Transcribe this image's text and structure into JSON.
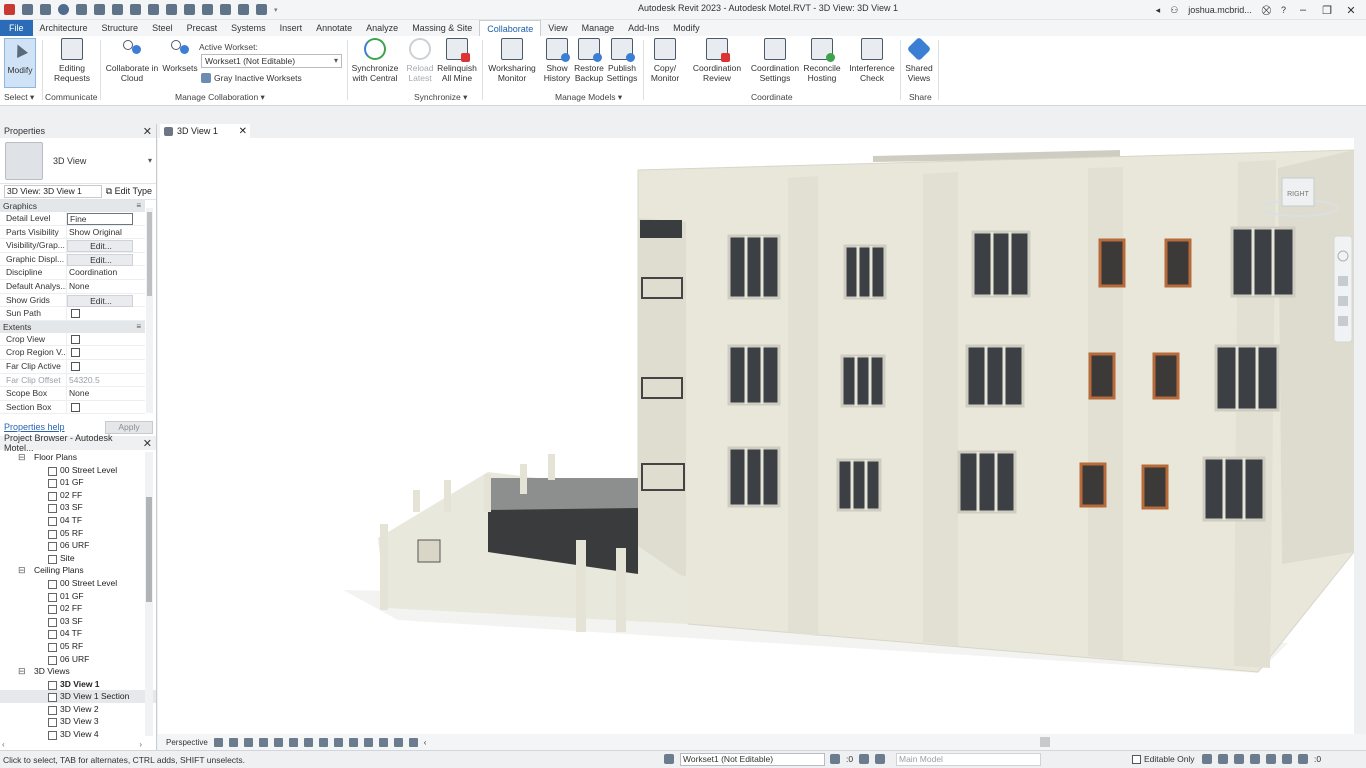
{
  "title_bar": {
    "title": "Autodesk Revit 2023 - Autodesk Motel.RVT - 3D View: 3D View 1",
    "user": "joshua.mcbrid..."
  },
  "tabs": [
    "File",
    "Architecture",
    "Structure",
    "Steel",
    "Precast",
    "Systems",
    "Insert",
    "Annotate",
    "Analyze",
    "Massing & Site",
    "Collaborate",
    "View",
    "Manage",
    "Add-Ins",
    "Modify"
  ],
  "ribbon": {
    "modify": "Modify",
    "editing_requests": "Editing\nRequests",
    "collaborate_cloud": "Collaborate in\nCloud",
    "worksets": "Worksets",
    "active_workset_label": "Active Workset:",
    "active_workset_value": "Workset1 (Not Editable)",
    "gray_inactive": "Gray Inactive Worksets",
    "sync_central": "Synchronize\nwith Central",
    "reload_latest": "Reload\nLatest",
    "relinquish": "Relinquish\nAll Mine",
    "worksharing_monitor": "Worksharing\nMonitor",
    "show_history": "Show\nHistory",
    "restore_backup": "Restore\nBackup",
    "publish_settings": "Publish\nSettings",
    "copy_monitor": "Copy/\nMonitor",
    "coordination_review": "Coordination\nReview",
    "coordination_settings": "Coordination\nSettings",
    "reconcile_hosting": "Reconcile\nHosting",
    "interference_check": "Interference\nCheck",
    "shared_views": "Shared\nViews",
    "panels": {
      "select": "Select",
      "communicate": "Communicate",
      "manage_collaboration": "Manage Collaboration",
      "synchronize": "Synchronize",
      "manage_models": "Manage Models",
      "coordinate": "Coordinate",
      "share": "Share"
    }
  },
  "properties": {
    "header": "Properties",
    "type_name": "3D View",
    "instance_selector": "3D View: 3D View 1",
    "edit_type": "Edit Type",
    "group_graphics": "Graphics",
    "group_extents": "Extents",
    "rows_graphics": [
      {
        "name": "Detail Level",
        "value": "Fine"
      },
      {
        "name": "Parts Visibility",
        "value": "Show Original"
      },
      {
        "name": "Visibility/Grap...",
        "value": "Edit..."
      },
      {
        "name": "Graphic Displ...",
        "value": "Edit..."
      },
      {
        "name": "Discipline",
        "value": "Coordination"
      },
      {
        "name": "Default Analys...",
        "value": "None"
      },
      {
        "name": "Show Grids",
        "value": "Edit..."
      },
      {
        "name": "Sun Path",
        "value": ""
      }
    ],
    "rows_extents": [
      {
        "name": "Crop View",
        "value": ""
      },
      {
        "name": "Crop Region V...",
        "value": ""
      },
      {
        "name": "Far Clip Active",
        "value": ""
      },
      {
        "name": "Far Clip Offset",
        "value": "54320.5"
      },
      {
        "name": "Scope Box",
        "value": "None"
      },
      {
        "name": "Section Box",
        "value": ""
      }
    ],
    "help_link": "Properties help",
    "apply": "Apply"
  },
  "browser": {
    "header": "Project Browser - Autodesk Motel...",
    "items": [
      {
        "label": "Floor Plans",
        "kind": "cat"
      },
      {
        "label": "00 Street Level",
        "kind": "view"
      },
      {
        "label": "01 GF",
        "kind": "view"
      },
      {
        "label": "02 FF",
        "kind": "view"
      },
      {
        "label": "03 SF",
        "kind": "view"
      },
      {
        "label": "04 TF",
        "kind": "view"
      },
      {
        "label": "05 RF",
        "kind": "view"
      },
      {
        "label": "06 URF",
        "kind": "view"
      },
      {
        "label": "Site",
        "kind": "view"
      },
      {
        "label": "Ceiling Plans",
        "kind": "cat"
      },
      {
        "label": "00 Street Level",
        "kind": "view"
      },
      {
        "label": "01 GF",
        "kind": "view"
      },
      {
        "label": "02 FF",
        "kind": "view"
      },
      {
        "label": "03 SF",
        "kind": "view"
      },
      {
        "label": "04 TF",
        "kind": "view"
      },
      {
        "label": "05 RF",
        "kind": "view"
      },
      {
        "label": "06 URF",
        "kind": "view"
      },
      {
        "label": "3D Views",
        "kind": "cat"
      },
      {
        "label": "3D View 1",
        "kind": "view",
        "bold": true
      },
      {
        "label": "3D View 1 Section",
        "kind": "view",
        "selected": true
      },
      {
        "label": "3D View 2",
        "kind": "view"
      },
      {
        "label": "3D View 3",
        "kind": "view"
      },
      {
        "label": "3D View 4",
        "kind": "view"
      }
    ]
  },
  "view": {
    "tab": "3D View 1",
    "viewcube_face": "RIGHT",
    "perspective": "Perspective"
  },
  "status": {
    "hint": "Click to select, TAB for alternates, CTRL adds, SHIFT unselects.",
    "coord": ":0",
    "workset": "Workset1 (Not Editable)",
    "model": "Main Model",
    "editable_only": "Editable Only",
    "filter_count": ":0"
  },
  "colors": {
    "accent": "#2b6cb8",
    "building": "#e6e5d8",
    "window_frame": "#b86a3a"
  }
}
